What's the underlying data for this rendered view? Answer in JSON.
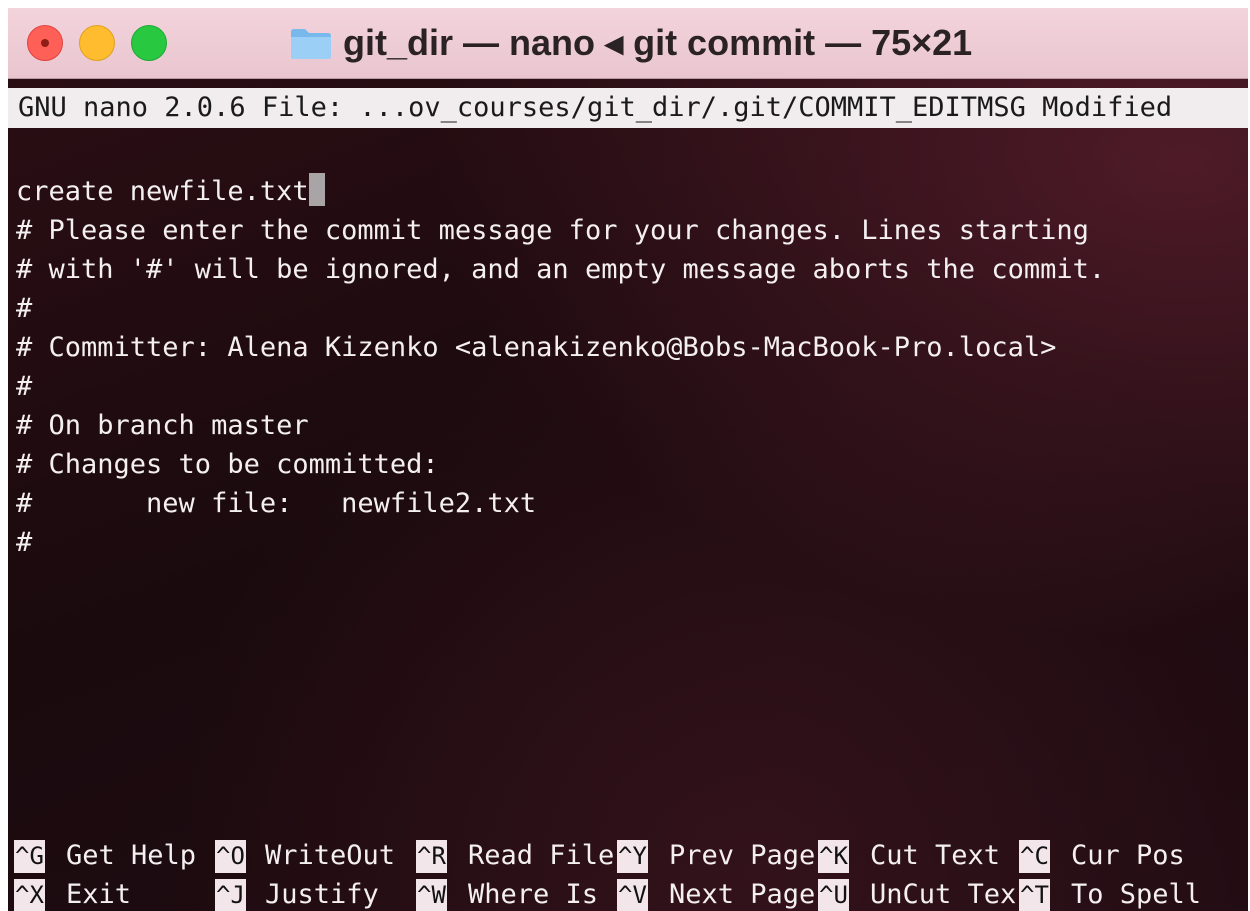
{
  "window": {
    "title": "git_dir — nano ◂ git commit — 75×21"
  },
  "nano": {
    "header": "GNU nano 2.0.6 File: ...ov_courses/git_dir/.git/COMMIT_EDITMSG Modified",
    "lines": [
      "create newfile.txt",
      "# Please enter the commit message for your changes. Lines starting",
      "# with '#' will be ignored, and an empty message aborts the commit.",
      "#",
      "# Committer: Alena Kizenko <alenakizenko@Bobs-MacBook-Pro.local>",
      "#",
      "# On branch master",
      "# Changes to be committed:",
      "#       new file:   newfile2.txt",
      "#"
    ],
    "shortcuts_row1": [
      {
        "key": "^G",
        "label": "Get Help"
      },
      {
        "key": "^O",
        "label": "WriteOut"
      },
      {
        "key": "^R",
        "label": "Read File"
      },
      {
        "key": "^Y",
        "label": "Prev Page"
      },
      {
        "key": "^K",
        "label": "Cut Text"
      },
      {
        "key": "^C",
        "label": "Cur Pos"
      }
    ],
    "shortcuts_row2": [
      {
        "key": "^X",
        "label": "Exit"
      },
      {
        "key": "^J",
        "label": "Justify"
      },
      {
        "key": "^W",
        "label": "Where Is"
      },
      {
        "key": "^V",
        "label": "Next Page"
      },
      {
        "key": "^U",
        "label": "UnCut Tex"
      },
      {
        "key": "^T",
        "label": "To Spell"
      }
    ]
  },
  "colors": {
    "background": "#1b0a0d",
    "text": "#f4eff0",
    "header_bg": "#f1ecee",
    "titlebar_bg": "#f3d3dc"
  }
}
